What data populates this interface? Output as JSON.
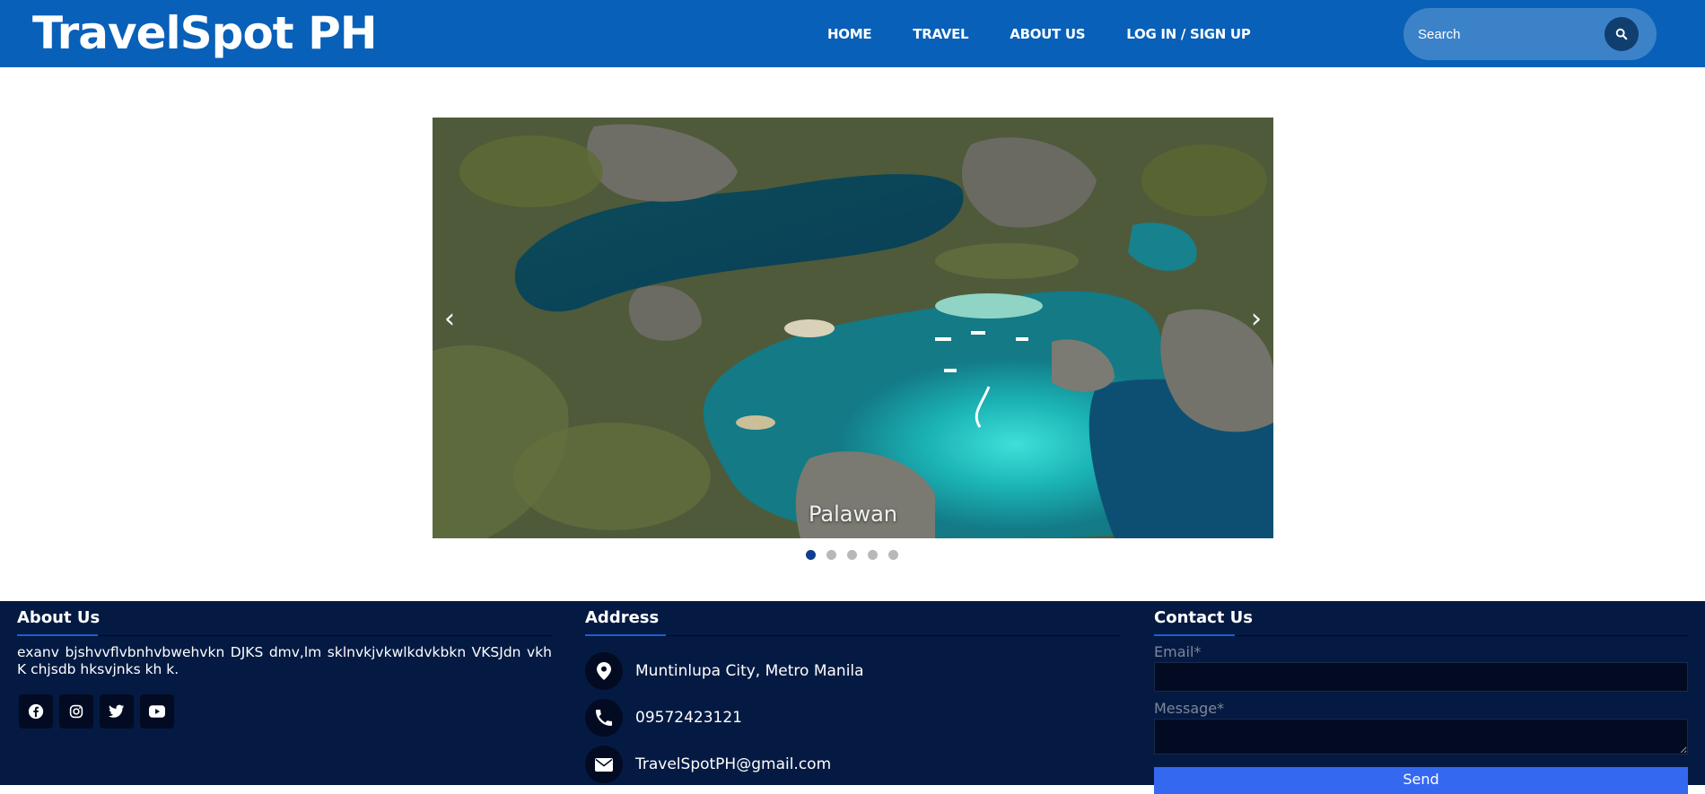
{
  "header": {
    "brand": "TravelSpot PH",
    "nav": [
      "HOME",
      "TRAVEL",
      "ABOUT US",
      "LOG IN / SIGN UP"
    ],
    "search_placeholder": "Search",
    "search_icon": "search-icon"
  },
  "carousel": {
    "caption": "Palawan",
    "prev_label": "‹",
    "next_label": "›",
    "dot_count": 5,
    "active_index": 0
  },
  "footer": {
    "about": {
      "title": "About Us",
      "text": "exanv bjshvvflvbnhvbwehvkn DJKS dmv,lm sklnvkjvkwlkdvkbkn VKSJdn vkh K chjsdb hksvjnks kh k.",
      "social_icons": [
        "facebook-icon",
        "instagram-icon",
        "twitter-icon",
        "youtube-icon"
      ]
    },
    "address": {
      "title": "Address",
      "location": "Muntinlupa City, Metro Manila",
      "phone": "09572423121",
      "email": "TravelSpotPH@gmail.com"
    },
    "contact": {
      "title": "Contact Us",
      "email_label": "Email*",
      "message_label": "Message*",
      "send_label": "Send"
    }
  },
  "colors": {
    "header_bg": "#0860b8",
    "footer_bg": "#041a42",
    "accent": "#1d5fd0",
    "send_button": "#3468f0"
  }
}
